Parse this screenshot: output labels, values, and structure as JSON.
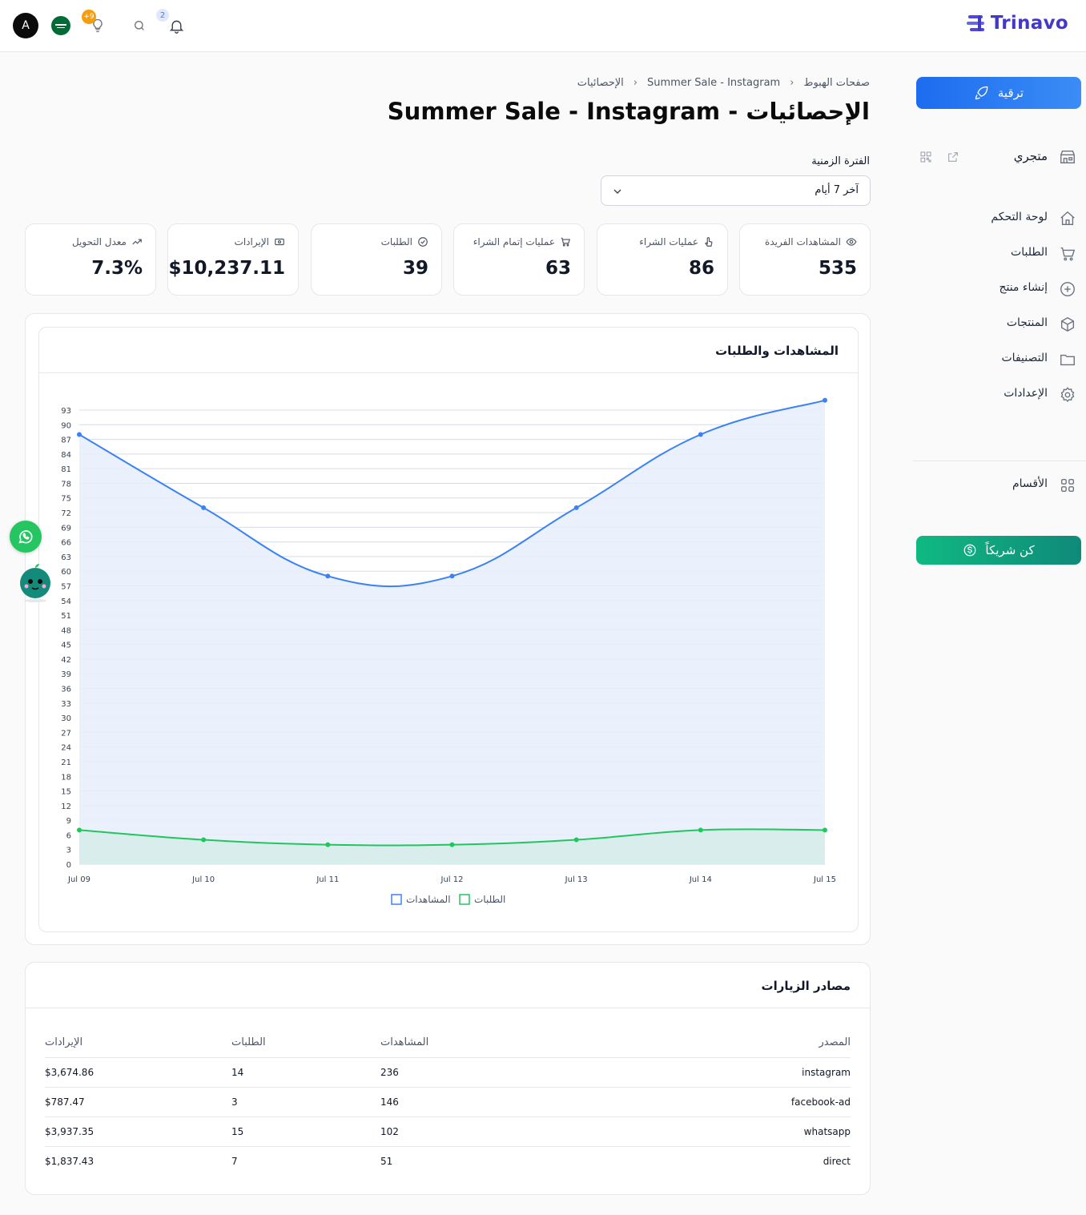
{
  "topbar": {
    "logo_text": "Trinavo",
    "avatar_letter": "A",
    "tips_badge": "+9",
    "notifications_badge": "2"
  },
  "sidebar": {
    "upgrade_label": "ترقية",
    "store_label": "متجري",
    "items": [
      {
        "label": "لوحة التحكم",
        "icon": "home-icon"
      },
      {
        "label": "الطلبات",
        "icon": "cart-icon"
      },
      {
        "label": "إنشاء منتج",
        "icon": "plus-circle-icon"
      },
      {
        "label": "المنتجات",
        "icon": "box-icon"
      },
      {
        "label": "التصنيفات",
        "icon": "folder-icon"
      },
      {
        "label": "الإعدادات",
        "icon": "gear-icon"
      }
    ],
    "sections_label": "الأقسام",
    "partner_label": "كن شريكاً"
  },
  "breadcrumb": [
    "صفحات الهبوط",
    "Summer Sale - Instagram",
    "الإحصائيات"
  ],
  "page_title": "الإحصائيات - Summer Sale - Instagram",
  "period": {
    "label": "الفترة الزمنية",
    "value": "آخر 7 أيام"
  },
  "stats": [
    {
      "label": "المشاهدات الفريدة",
      "value": "535",
      "icon": "eye-icon"
    },
    {
      "label": "عمليات الشراء",
      "value": "86",
      "icon": "pointer-icon"
    },
    {
      "label": "عمليات إتمام الشراء",
      "value": "63",
      "icon": "cart-icon"
    },
    {
      "label": "الطلبات",
      "value": "39",
      "icon": "check-circle-icon"
    },
    {
      "label": "الإيرادات",
      "value": "$10,237.11",
      "icon": "cash-icon"
    },
    {
      "label": "معدل التحويل",
      "value": "7.3%",
      "icon": "trend-up-icon"
    }
  ],
  "chart_panel": {
    "title": "المشاهدات والطلبات"
  },
  "chart_data": {
    "type": "area",
    "x": [
      "Jul 09",
      "Jul 10",
      "Jul 11",
      "Jul 12",
      "Jul 13",
      "Jul 14",
      "Jul 15"
    ],
    "series": [
      {
        "name": "المشاهدات",
        "values": [
          88,
          73,
          59,
          59,
          73,
          88,
          95
        ],
        "color": "#3b82f6",
        "fill": "#e8eefb"
      },
      {
        "name": "الطلبات",
        "values": [
          7,
          5,
          4,
          4,
          5,
          7,
          7
        ],
        "color": "#22c55e",
        "fill": "#d6ece9"
      }
    ],
    "ylim": [
      0,
      93
    ],
    "yticks": [
      0,
      3,
      6,
      9,
      12,
      15,
      18,
      21,
      24,
      27,
      30,
      33,
      36,
      39,
      42,
      45,
      48,
      51,
      54,
      57,
      60,
      63,
      66,
      69,
      72,
      75,
      78,
      81,
      84,
      87,
      90,
      93
    ],
    "grid": true,
    "legend": "bottom-center"
  },
  "sources": {
    "title": "مصادر الزيارات",
    "columns": [
      "المصدر",
      "المشاهدات",
      "الطلبات",
      "الإيرادات"
    ],
    "rows": [
      {
        "source": "instagram",
        "views": "236",
        "orders": "14",
        "revenue": "$3,674.86"
      },
      {
        "source": "facebook-ad",
        "views": "146",
        "orders": "3",
        "revenue": "$787.47"
      },
      {
        "source": "whatsapp",
        "views": "102",
        "orders": "15",
        "revenue": "$3,937.35"
      },
      {
        "source": "direct",
        "views": "51",
        "orders": "7",
        "revenue": "$1,837.43"
      }
    ]
  }
}
